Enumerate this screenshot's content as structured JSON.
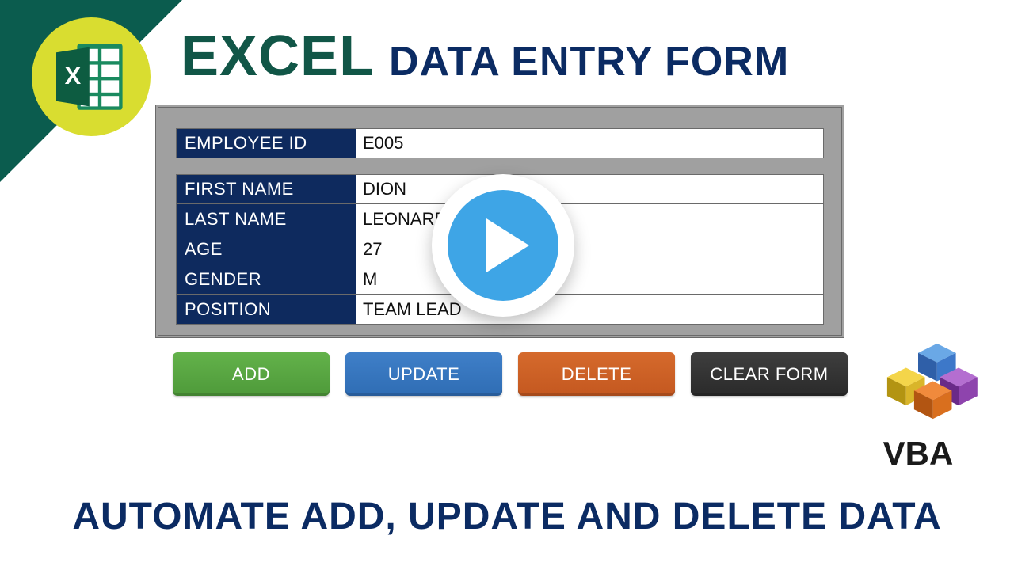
{
  "title": {
    "word1": "EXCEL",
    "rest": "DATA ENTRY FORM"
  },
  "form": {
    "employee_id": {
      "label": "EMPLOYEE ID",
      "value": "E005"
    },
    "first_name": {
      "label": "FIRST NAME",
      "value": "DION"
    },
    "last_name": {
      "label": "LAST NAME",
      "value": "LEONARD"
    },
    "age": {
      "label": "AGE",
      "value": "27"
    },
    "gender": {
      "label": "GENDER",
      "value": "M"
    },
    "position": {
      "label": "POSITION",
      "value": "TEAM LEAD"
    }
  },
  "buttons": {
    "add": "ADD",
    "update": "UPDATE",
    "delete": "DELETE",
    "clear": "CLEAR FORM"
  },
  "vba_label": "VBA",
  "subtitle": "AUTOMATE ADD, UPDATE AND DELETE DATA",
  "colors": {
    "corner": "#0b5c4e",
    "label_bg": "#0e2a5e",
    "btn_add": "#4e9a3a",
    "btn_update": "#2f6db4",
    "btn_delete": "#c45820",
    "btn_clear": "#2a2a2a"
  }
}
